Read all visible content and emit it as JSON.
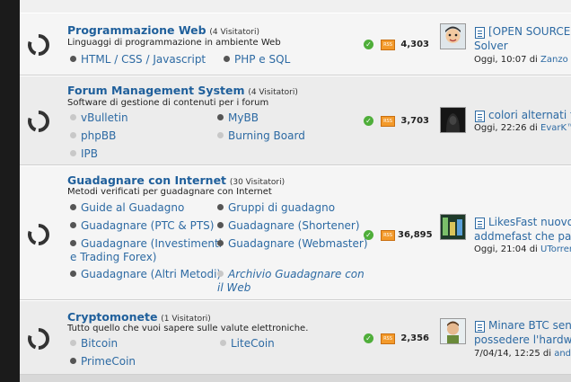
{
  "forums": [
    {
      "title": "Programmazione Web",
      "visitors": "(4 Visitatori)",
      "description": "Linguaggi di programmazione in ambiente Web",
      "subforums": [
        "HTML / CSS / Javascript",
        "PHP e SQL"
      ],
      "count": "4,303",
      "last_post": {
        "title_line1": "[OPEN SOURCE]",
        "title_line2": "Solver",
        "date": "Oggi, 10:07 di",
        "user": "Zanzo"
      }
    },
    {
      "title": "Forum Management System",
      "visitors": "(4 Visitatori)",
      "description": "Software di gestione di contenuti per i forum",
      "subforums": [
        "vBulletin",
        "MyBB",
        "phpBB",
        "Burning Board",
        "IPB"
      ],
      "count": "3,703",
      "last_post": {
        "title_line1": "colori alternati f",
        "date": "Oggi, 22:26 di",
        "user": "EvarK™"
      }
    },
    {
      "title": "Guadagnare con Internet",
      "visitors": "(30 Visitatori)",
      "description": "Metodi verificati per guadagnare con Internet",
      "subforums": [
        "Guide al Guadagno",
        "Gruppi di guadagno",
        "Guadagnare (PTC & PTS)",
        "Guadagnare (Shortener)",
        "Guadagnare (Investimenti e Trading Forex)",
        "Guadagnare (Webmaster)",
        "Guadagnare (Altri Metodi)",
        "Archivio Guadagnare con il Web"
      ],
      "count": "36,895",
      "last_post": {
        "title_line1": "LikesFast nuovo",
        "title_line2": "addmefast che pag",
        "date": "Oggi, 21:04 di",
        "user": "UTorren"
      }
    },
    {
      "title": "Cryptomonete",
      "visitors": "(1 Visitatori)",
      "description": "Tutto quello che vuoi sapere sulle valute elettroniche.",
      "subforums": [
        "Bitcoin",
        "LiteCoin",
        "PrimeCoin"
      ],
      "count": "2,356",
      "last_post": {
        "title_line1": "Minare BTC sen",
        "title_line2": "possedere l'hardwa",
        "date": "7/04/14, 12:25 di",
        "user": "andr"
      }
    }
  ],
  "icons": {
    "status": "check-icon",
    "feed": "rss-icon",
    "forum": "forum-status-icon",
    "post": "post-icon"
  },
  "colors": {
    "link": "#2d6aa3",
    "title": "#1f5f9b",
    "check": "#4fae3a",
    "rss": "#f39a2b"
  }
}
